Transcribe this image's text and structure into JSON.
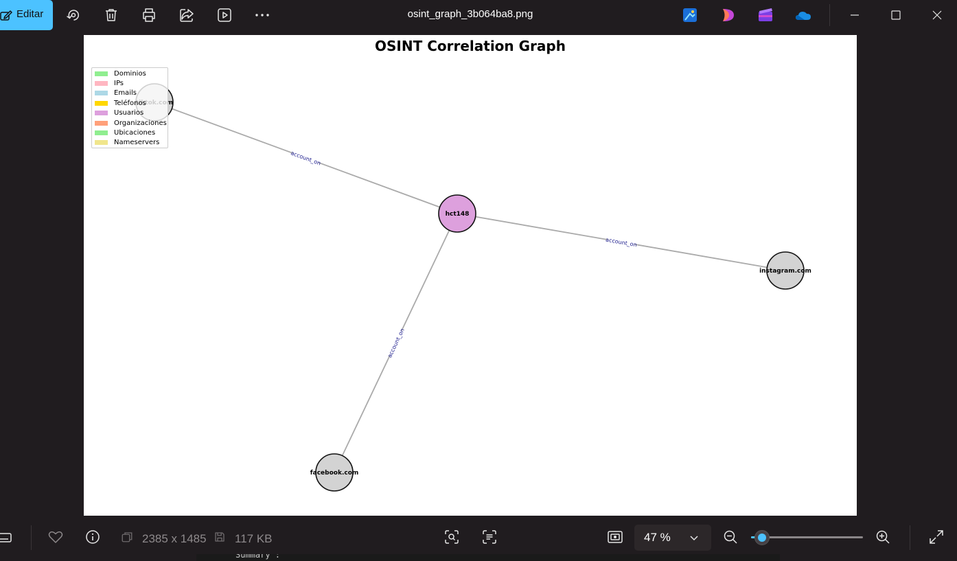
{
  "window": {
    "title": "osint_graph_3b064ba8.png",
    "edit_label": "Editar"
  },
  "toolbar_icons": [
    "edit-pencil-icon",
    "rotate-icon",
    "delete-icon",
    "print-icon",
    "share-icon",
    "slideshow-icon",
    "more-icon"
  ],
  "app_icons": [
    "photo-editor-app-icon",
    "clipchamp-app-icon",
    "video-editor-app-icon",
    "onedrive-icon"
  ],
  "graph": {
    "title": "OSINT Correlation Graph",
    "legend": [
      {
        "label": "Dominios",
        "color": "#90ee90"
      },
      {
        "label": "IPs",
        "color": "#ffb6c1"
      },
      {
        "label": "Emails",
        "color": "#add8e6"
      },
      {
        "label": "Teléfonos",
        "color": "#ffd700"
      },
      {
        "label": "Usuarios",
        "color": "#dda0dd"
      },
      {
        "label": "Organizaciones",
        "color": "#ffa07a"
      },
      {
        "label": "Ubicaciones",
        "color": "#90ee90"
      },
      {
        "label": "Nameservers",
        "color": "#f0e68c"
      }
    ],
    "nodes": [
      {
        "id": "hct148",
        "label": "hct148",
        "color": "#dda0dd"
      },
      {
        "id": "tiktok.com",
        "label": "tiktok.com",
        "color": "#d3d3d3"
      },
      {
        "id": "instagram.com",
        "label": "instagram.com",
        "color": "#d3d3d3"
      },
      {
        "id": "facebook.com",
        "label": "facebook.com",
        "color": "#d3d3d3"
      }
    ],
    "edges": [
      {
        "source": "hct148",
        "target": "tiktok.com",
        "label": "account_on"
      },
      {
        "source": "hct148",
        "target": "instagram.com",
        "label": "account_on"
      },
      {
        "source": "hct148",
        "target": "facebook.com",
        "label": "account_on"
      }
    ]
  },
  "status": {
    "dimensions": "2385 x 1485",
    "file_size": "117 KB",
    "zoom": "47 %",
    "zoom_fraction": 0.1
  },
  "peek_text": "Summary :"
}
